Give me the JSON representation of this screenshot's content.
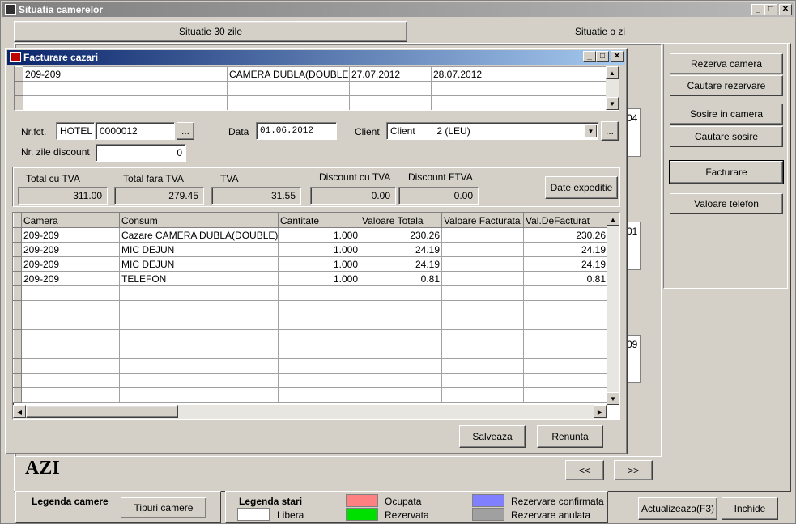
{
  "main_window": {
    "title": "Situatia camerelor",
    "tabs": [
      {
        "label": "Situatie 30 zile"
      },
      {
        "label": "Situatie o zi"
      }
    ],
    "side_buttons": {
      "rezerva": "Rezerva camera",
      "cautare_rezervare": "Cautare rezervare",
      "sosire": "Sosire in camera",
      "cautare_sosire": "Cautare sosire",
      "facturare": "Facturare",
      "valoare_telefon": "Valoare telefon"
    },
    "peek_texts": [
      "04",
      "01",
      "09"
    ],
    "azi": "AZI",
    "nav_prev": "<<",
    "nav_next": ">>"
  },
  "legend": {
    "camere_title": "Legenda camere",
    "tipuri_button": "Tipuri camere",
    "stari_title": "Legenda stari",
    "items": {
      "libera": {
        "label": "Libera",
        "color": "#ffffff"
      },
      "ocupata": {
        "label": "Ocupata",
        "color": "#ff8080"
      },
      "rezervata": {
        "label": "Rezervata",
        "color": "#00e000"
      },
      "confirmata": {
        "label": "Rezervare confirmata",
        "color": "#8080ff"
      },
      "anulata": {
        "label": "Rezervare anulata",
        "color": "#a0a0a0"
      }
    },
    "actualizeaza": "Actualizeaza(F3)",
    "inchide": "Inchide"
  },
  "dialog": {
    "title": "Facturare cazari",
    "top_grid": {
      "rows": [
        [
          "209-209",
          "CAMERA DUBLA(DOUBLE",
          "27.07.2012",
          "28.07.2012",
          ""
        ],
        [
          "",
          "",
          "",
          "",
          ""
        ],
        [
          "",
          "",
          "",
          "",
          ""
        ]
      ]
    },
    "nrfct_label": "Nr.fct.",
    "nrfct_series": "HOTEL",
    "nrfct_number": "0000012",
    "ellipsis": "...",
    "data_label": "Data",
    "data_value": "01.06.2012",
    "client_label": "Client",
    "client_value": "Client        2 (LEU)",
    "zile_label": "Nr. zile discount",
    "zile_value": "0",
    "totals": {
      "total_cu_tva_label": "Total cu TVA",
      "total_cu_tva": "311.00",
      "total_fara_tva_label": "Total fara TVA",
      "total_fara_tva": "279.45",
      "tva_label": "TVA",
      "tva": "31.55",
      "discount_cu_tva_label": "Discount cu TVA",
      "discount_cu_tva": "0.00",
      "discount_ftva_label": "Discount FTVA",
      "discount_ftva": "0.00"
    },
    "date_expeditie": "Date expeditie",
    "grid": {
      "columns": [
        "Camera",
        "Consum",
        "Cantitate",
        "Valoare Totala",
        "Valoare Facturata",
        "Val.DeFacturat"
      ],
      "rows": [
        [
          "209-209",
          "Cazare CAMERA DUBLA(DOUBLE)",
          "1.000",
          "230.26",
          "",
          "230.26"
        ],
        [
          "209-209",
          "MIC DEJUN",
          "1.000",
          "24.19",
          "",
          "24.19"
        ],
        [
          "209-209",
          "MIC DEJUN",
          "1.000",
          "24.19",
          "",
          "24.19"
        ],
        [
          "209-209",
          "TELEFON",
          "1.000",
          "0.81",
          "",
          "0.81"
        ]
      ]
    },
    "salveaza": "Salveaza",
    "renunta": "Renunta"
  }
}
